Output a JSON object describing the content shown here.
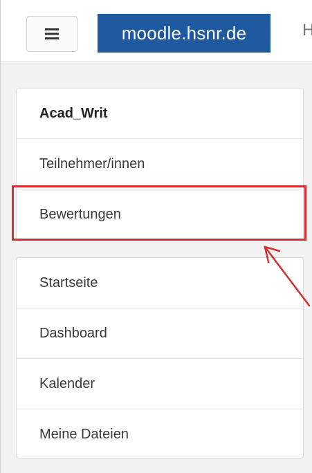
{
  "header": {
    "menu_icon": "hamburger-icon",
    "brand": "moodle.hsnr.de",
    "cut_text": "H"
  },
  "course_block": {
    "items": [
      {
        "label": "Acad_Writ"
      },
      {
        "label": "Teilnehmer/innen"
      },
      {
        "label": "Bewertungen"
      }
    ]
  },
  "site_block": {
    "items": [
      {
        "label": "Startseite"
      },
      {
        "label": "Dashboard"
      },
      {
        "label": "Kalender"
      },
      {
        "label": "Meine Dateien"
      }
    ]
  },
  "annotation": {
    "color": "#d32f2f",
    "icon": "arrow-icon"
  },
  "colors": {
    "brand": "#1f5aa0"
  }
}
